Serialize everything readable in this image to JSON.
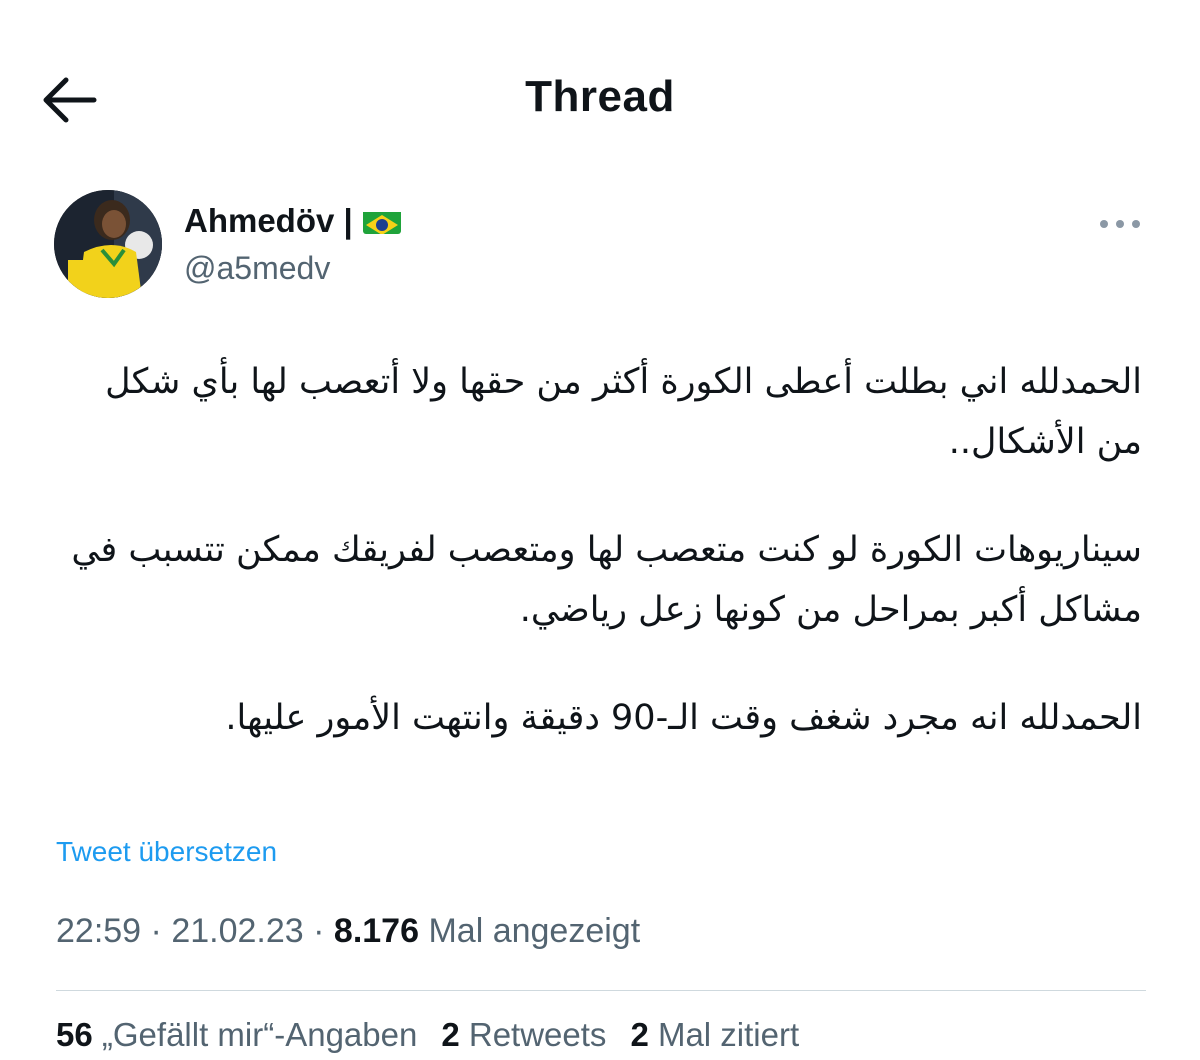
{
  "header": {
    "title": "Thread"
  },
  "tweet": {
    "author": {
      "display_name": "Ahmedöv |",
      "handle": "@a5medv"
    },
    "paragraphs": [
      "الحمدلله اني بطلت أعطى الكورة أكثر من حقها ولا أتعصب لها بأي شكل من الأشكال..",
      "سيناريوهات الكورة لو كنت متعصب لها ومتعصب لفريقك ممكن تتسبب في مشاكل أكبر بمراحل من كونها زعل رياضي.",
      "الحمدلله انه مجرد شغف وقت الـ-90 دقيقة وانتهت الأمور عليها."
    ],
    "translate_label": "Tweet übersetzen",
    "time": "22:59",
    "date": "21.02.23",
    "views_count": "8.176",
    "views_label": "Mal angezeigt",
    "sep": "·"
  },
  "stats": {
    "likes_count": "56",
    "likes_label": "„Gefällt mir“-Angaben",
    "retweets_count": "2",
    "retweets_label": "Retweets",
    "quotes_count": "2",
    "quotes_label": "Mal zitiert"
  },
  "icons": {
    "back": "arrow-left-icon",
    "more": "more-horizontal-icon",
    "flag": "brazil-flag-icon"
  },
  "colors": {
    "link": "#1d9bf0",
    "secondary": "#536471",
    "text": "#0f1419"
  }
}
